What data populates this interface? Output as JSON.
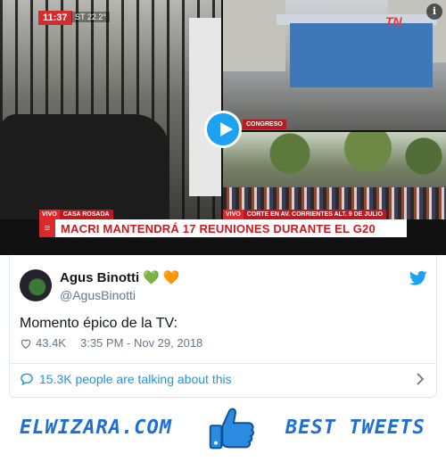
{
  "video": {
    "clock": "11:37",
    "temperature": "ST 22.2°",
    "channel_logo": "TN",
    "info": "i",
    "tags": [
      {
        "live": "VIVO",
        "place": "CASA ROSADA"
      },
      {
        "live": "",
        "place": "CONGRESO"
      },
      {
        "live": "VIVO",
        "place": "CORTE EN AV. CORRIENTES ALT. 9 DE JULIO"
      }
    ],
    "headline": "MACRI MANTENDRÁ 17 REUNIONES DURANTE EL G20",
    "menu_glyph": "≡"
  },
  "tweet": {
    "display_name": "Agus Binotti",
    "emoji_green": "💚",
    "emoji_orange": "🧡",
    "handle": "@AgusBinotti",
    "text": "Momento épico de la TV:",
    "likes": "43.4K",
    "timestamp": "3:35 PM - Nov 29, 2018",
    "talking": "15.3K people are talking about this"
  },
  "footer": {
    "site": "ELWIZARA.COM",
    "tagline": "BEST TWEETS"
  },
  "colors": {
    "twitter_blue": "#1da1f2",
    "link_blue": "#1b95e0",
    "brand_blue": "#1f6ed4",
    "headline_red": "#c81b21"
  }
}
